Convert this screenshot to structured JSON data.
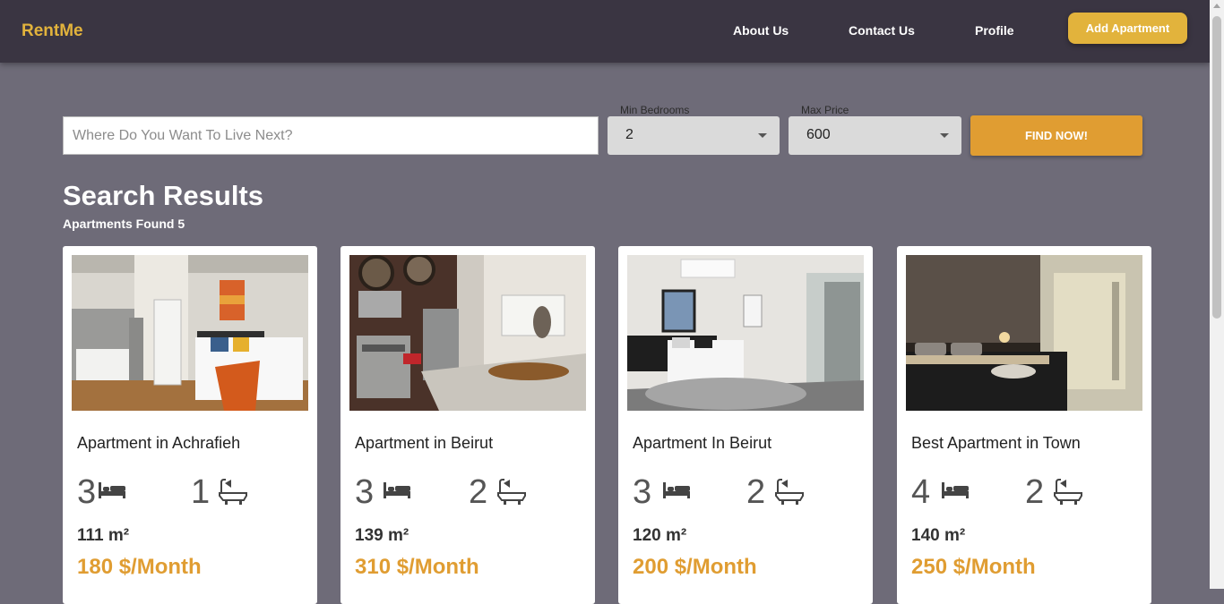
{
  "navbar": {
    "brand": "RentMe",
    "links": [
      "About Us",
      "Contact Us",
      "Profile"
    ],
    "add_button": "Add Apartment"
  },
  "search": {
    "placeholder": "Where Do You Want To Live Next?",
    "min_bedrooms_label": "Min Bedrooms",
    "min_bedrooms_value": "2",
    "max_price_label": "Max Price",
    "max_price_value": "600",
    "find_button": "FIND NOW!"
  },
  "results": {
    "title": "Search Results",
    "count_text": "Apartments Found 5",
    "cards": [
      {
        "title": "Apartment in Achrafieh",
        "bedrooms": "3",
        "bathrooms": "1",
        "area": "111 m²",
        "price": "180 $/Month"
      },
      {
        "title": "Apartment in Beirut",
        "bedrooms": "3",
        "bathrooms": "2",
        "area": "139 m²",
        "price": "310 $/Month"
      },
      {
        "title": "Apartment In Beirut",
        "bedrooms": "3",
        "bathrooms": "2",
        "area": "120 m²",
        "price": "200 $/Month"
      },
      {
        "title": "Best Apartment in Town",
        "bedrooms": "4",
        "bathrooms": "2",
        "area": "140 m²",
        "price": "250 $/Month"
      }
    ]
  },
  "icons": {
    "bed": "bed-icon",
    "bath": "bathtub-icon",
    "dropdown": "chevron-down-icon"
  },
  "colors": {
    "navbar_bg": "#3a3542",
    "page_bg": "#6e6b78",
    "accent": "#e2b33c",
    "button": "#e09d32"
  }
}
